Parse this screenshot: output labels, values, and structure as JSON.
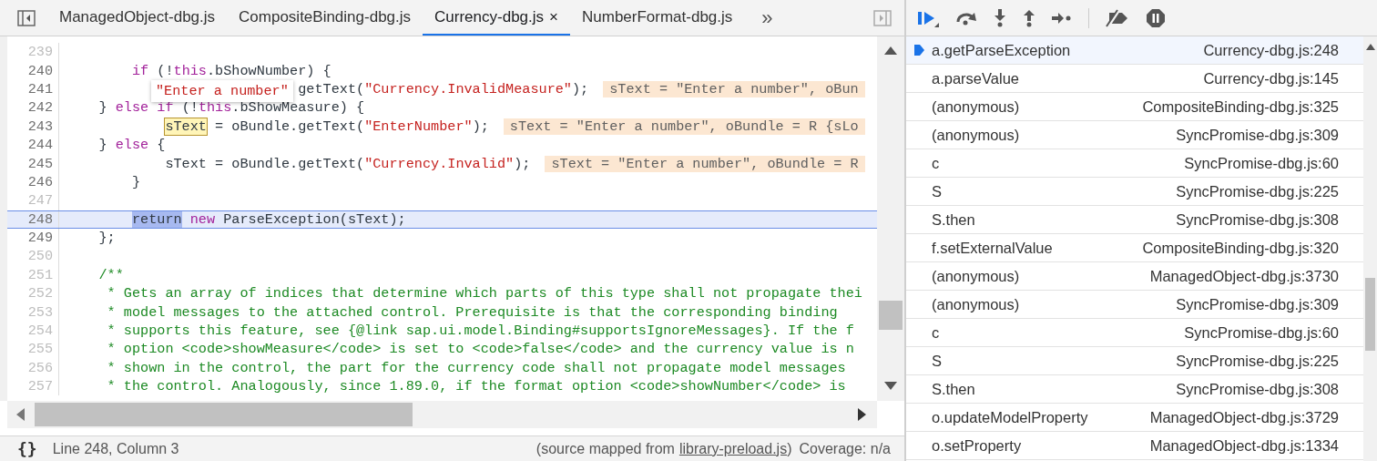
{
  "tabs": [
    {
      "label": "ManagedObject-dbg.js",
      "selected": false
    },
    {
      "label": "CompositeBinding-dbg.js",
      "selected": false
    },
    {
      "label": "Currency-dbg.js",
      "selected": true,
      "close": "×"
    },
    {
      "label": "NumberFormat-dbg.js",
      "selected": false
    }
  ],
  "tab_overflow": "»",
  "editor": {
    "lines": [
      {
        "number": "239",
        "mapped": false,
        "current": false
      },
      {
        "number": "240",
        "mapped": true,
        "current": false,
        "tokens": [
          {
            "kind": "keyword",
            "text": "        if"
          },
          {
            "kind": "plain",
            "text": " (!"
          },
          {
            "kind": "keyword",
            "text": "this"
          },
          {
            "kind": "plain",
            "text": ".bShowNumber) {"
          }
        ]
      },
      {
        "number": "241",
        "mapped": true,
        "current": false,
        "tokens": [
          {
            "kind": "plain",
            "text": "                            getText("
          },
          {
            "kind": "string",
            "text": "\"Currency.InvalidMeasure\""
          },
          {
            "kind": "plain",
            "text": ");"
          }
        ],
        "inline_value": "sText = \"Enter a number\", oBun"
      },
      {
        "number": "242",
        "mapped": true,
        "current": false,
        "tokens": [
          {
            "kind": "plain",
            "text": "    } "
          },
          {
            "kind": "keyword",
            "text": "else if"
          },
          {
            "kind": "plain",
            "text": " (!"
          },
          {
            "kind": "keyword",
            "text": "this"
          },
          {
            "kind": "plain",
            "text": ".bShowMeasure) {"
          }
        ]
      },
      {
        "number": "243",
        "mapped": true,
        "current": false,
        "tokens": [
          {
            "kind": "hover",
            "text": "            sText"
          },
          {
            "kind": "plain",
            "text": " = oBundle.getText("
          },
          {
            "kind": "string",
            "text": "\"EnterNumber\""
          },
          {
            "kind": "plain",
            "text": ");"
          }
        ],
        "inline_value": "sText = \"Enter a number\", oBundle = R {sLo"
      },
      {
        "number": "244",
        "mapped": true,
        "current": false,
        "tokens": [
          {
            "kind": "plain",
            "text": "    } "
          },
          {
            "kind": "keyword",
            "text": "else"
          },
          {
            "kind": "plain",
            "text": " {"
          }
        ]
      },
      {
        "number": "245",
        "mapped": true,
        "current": false,
        "tokens": [
          {
            "kind": "plain",
            "text": "            sText = oBundle.getText("
          },
          {
            "kind": "string",
            "text": "\"Currency.Invalid\""
          },
          {
            "kind": "plain",
            "text": ");"
          }
        ],
        "inline_value": "sText = \"Enter a number\", oBundle = R"
      },
      {
        "number": "246",
        "mapped": true,
        "current": false,
        "tokens": [
          {
            "kind": "plain",
            "text": "        }"
          }
        ]
      },
      {
        "number": "247",
        "mapped": false,
        "current": false
      },
      {
        "number": "248",
        "mapped": true,
        "current": true,
        "tokens": [
          {
            "kind": "selection",
            "text": "        return"
          },
          {
            "kind": "keyword",
            "text": " new"
          },
          {
            "kind": "plain",
            "text": " ParseException(sText);"
          }
        ]
      },
      {
        "number": "249",
        "mapped": true,
        "current": false,
        "tokens": [
          {
            "kind": "plain",
            "text": "    };"
          }
        ]
      },
      {
        "number": "250",
        "mapped": false,
        "current": false
      },
      {
        "number": "251",
        "mapped": false,
        "current": false,
        "tokens": [
          {
            "kind": "comment",
            "text": "    /**"
          }
        ]
      },
      {
        "number": "252",
        "mapped": false,
        "current": false,
        "tokens": [
          {
            "kind": "comment",
            "text": "     * Gets an array of indices that determine which parts of this type shall not propagate thei"
          }
        ]
      },
      {
        "number": "253",
        "mapped": false,
        "current": false,
        "tokens": [
          {
            "kind": "comment",
            "text": "     * model messages to the attached control. Prerequisite is that the corresponding binding"
          }
        ]
      },
      {
        "number": "254",
        "mapped": false,
        "current": false,
        "tokens": [
          {
            "kind": "comment",
            "text": "     * supports this feature, see {@link sap.ui.model.Binding#supportsIgnoreMessages}. If the f"
          }
        ]
      },
      {
        "number": "255",
        "mapped": false,
        "current": false,
        "tokens": [
          {
            "kind": "comment",
            "text": "     * option <code>showMeasure</code> is set to <code>false</code> and the currency value is n"
          }
        ]
      },
      {
        "number": "256",
        "mapped": false,
        "current": false,
        "tokens": [
          {
            "kind": "comment",
            "text": "     * shown in the control, the part for the currency code shall not propagate model messages"
          }
        ]
      },
      {
        "number": "257",
        "mapped": false,
        "current": false,
        "tokens": [
          {
            "kind": "comment",
            "text": "     * the control. Analogously, since 1.89.0, if the format option <code>showNumber</code> is"
          }
        ]
      }
    ],
    "tooltip": "\"Enter a number\""
  },
  "status": {
    "format_icon": "{}",
    "position": "Line 248, Column 3",
    "source_before": "(source mapped from",
    "source_link": "library-preload.js",
    "source_after": ")",
    "coverage": "Coverage: n/a"
  },
  "call_stack": [
    {
      "name": "a.getParseException",
      "location": "Currency-dbg.js:248",
      "current": true
    },
    {
      "name": "a.parseValue",
      "location": "Currency-dbg.js:145",
      "current": false
    },
    {
      "name": "(anonymous)",
      "location": "CompositeBinding-dbg.js:325",
      "current": false
    },
    {
      "name": "(anonymous)",
      "location": "SyncPromise-dbg.js:309",
      "current": false
    },
    {
      "name": "c",
      "location": "SyncPromise-dbg.js:60",
      "current": false
    },
    {
      "name": "S",
      "location": "SyncPromise-dbg.js:225",
      "current": false
    },
    {
      "name": "S.then",
      "location": "SyncPromise-dbg.js:308",
      "current": false
    },
    {
      "name": "f.setExternalValue",
      "location": "CompositeBinding-dbg.js:320",
      "current": false
    },
    {
      "name": "(anonymous)",
      "location": "ManagedObject-dbg.js:3730",
      "current": false
    },
    {
      "name": "(anonymous)",
      "location": "SyncPromise-dbg.js:309",
      "current": false
    },
    {
      "name": "c",
      "location": "SyncPromise-dbg.js:60",
      "current": false
    },
    {
      "name": "S",
      "location": "SyncPromise-dbg.js:225",
      "current": false
    },
    {
      "name": "S.then",
      "location": "SyncPromise-dbg.js:308",
      "current": false
    },
    {
      "name": "o.updateModelProperty",
      "location": "ManagedObject-dbg.js:3729",
      "current": false
    },
    {
      "name": "o.setProperty",
      "location": "ManagedObject-dbg.js:1334",
      "current": false
    }
  ]
}
